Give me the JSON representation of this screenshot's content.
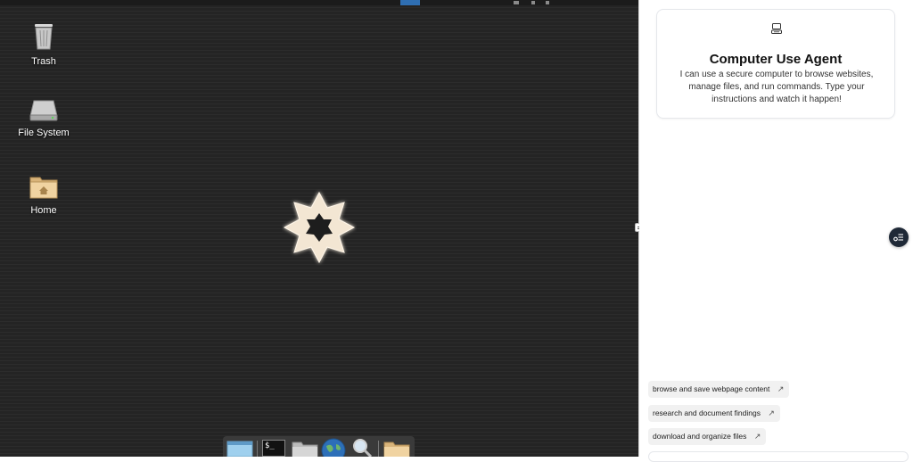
{
  "desktop": {
    "icons": [
      {
        "label": "Trash",
        "icon": "trash-icon"
      },
      {
        "label": "File System",
        "icon": "drive-icon"
      },
      {
        "label": "Home",
        "icon": "home-folder-icon"
      }
    ],
    "center_logo": "star-logo-icon",
    "dock": [
      {
        "icon": "window-icon"
      },
      {
        "icon": "terminal-icon",
        "text": "$_"
      },
      {
        "icon": "file-manager-icon"
      },
      {
        "icon": "web-browser-icon"
      },
      {
        "icon": "search-magnifier-icon"
      },
      {
        "icon": "folder-icon"
      }
    ]
  },
  "agent": {
    "title": "Computer Use Agent",
    "description": "I can use a secure computer to browse websites, manage files, and run commands. Type your instructions and watch it happen!",
    "icon": "computer-agent-icon",
    "suggestions": [
      "browse and save webpage content",
      "research and document findings",
      "download and organize files"
    ],
    "suggestion_arrow": "↗"
  },
  "colors": {
    "desktop_bg": "#242424",
    "panel_bg": "#ffffff",
    "accent": "#2f6fb3",
    "fab": "#1f2937"
  }
}
